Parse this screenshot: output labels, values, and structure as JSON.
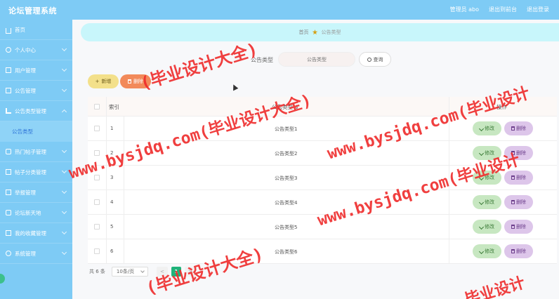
{
  "header": {
    "title": "论坛管理系统",
    "user_label": "管理员 abo",
    "back_label": "退出到前台",
    "logout_label": "退出登录"
  },
  "sidebar": {
    "items": [
      {
        "label": "首页",
        "icon": "home-icon"
      },
      {
        "label": "个人中心",
        "icon": "user-icon"
      },
      {
        "label": "用户管理",
        "icon": "grid-icon"
      },
      {
        "label": "公告管理",
        "icon": "grid-icon"
      },
      {
        "label": "公告类型管理",
        "icon": "bars-icon"
      },
      {
        "label": "热门帖子管理",
        "icon": "chat-icon"
      },
      {
        "label": "帖子分类管理",
        "icon": "grid-icon"
      },
      {
        "label": "举报管理",
        "icon": "grid-icon"
      },
      {
        "label": "论坛新天地",
        "icon": "chat-icon"
      },
      {
        "label": "我的收藏管理",
        "icon": "grid-icon"
      },
      {
        "label": "系统管理",
        "icon": "gear-icon"
      }
    ],
    "active_sub": "公告类型"
  },
  "breadcrumb": {
    "home": "首页",
    "current": "公告类型"
  },
  "search": {
    "label": "公告类型",
    "placeholder": "公告类型",
    "button": "查询"
  },
  "actions": {
    "add": "新增",
    "delete": "删除"
  },
  "table": {
    "headers": {
      "index": "索引",
      "type": "公告类型",
      "action": "操作"
    },
    "edit_label": "修改",
    "delete_label": "删除",
    "rows": [
      {
        "index": "1",
        "type": "公告类型1"
      },
      {
        "index": "2",
        "type": "公告类型2"
      },
      {
        "index": "3",
        "type": "公告类型3"
      },
      {
        "index": "4",
        "type": "公告类型4"
      },
      {
        "index": "5",
        "type": "公告类型5"
      },
      {
        "index": "6",
        "type": "公告类型6"
      }
    ]
  },
  "pagination": {
    "total": "共 6 条",
    "page_size": "10条/页",
    "prev": "<",
    "current": "1",
    "next": ">"
  },
  "watermarks": [
    "(毕业设计大全)",
    "www.bysjdq.com(毕业设计大全)",
    "www.bysjdq.com(毕业设计",
    "www.bysjdq.com(毕业设计",
    "(毕业设计大全)",
    "毕业设计"
  ],
  "colors": {
    "sidebar": "#7ecbf5",
    "header": "#7ecbf5",
    "accent": "#1fb37a",
    "watermark": "#ef2b2b"
  }
}
